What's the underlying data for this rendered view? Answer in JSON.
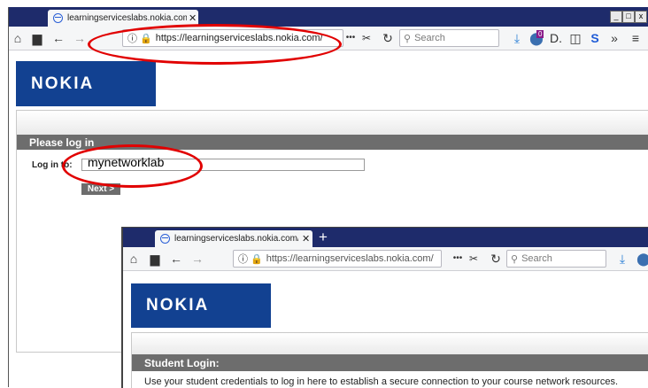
{
  "back_browser": {
    "tab_title": "learningserviceslabs.nokia.com/...",
    "url": "https://learningserviceslabs.nokia.com/",
    "search_placeholder": "Search",
    "more_label": "•••",
    "window_controls": {
      "minimize": "_",
      "maximize": "□",
      "close": "x"
    },
    "badge_count": "0"
  },
  "back_page": {
    "logo": "NOKIA",
    "section_title": "Please log in",
    "login_label": "Log in to:",
    "login_value": "mynetworklab",
    "next_button": "Next >"
  },
  "front_browser": {
    "tab_title": "learningserviceslabs.nokia.com/...",
    "new_tab": "+",
    "url": "https://learningserviceslabs.nokia.com/",
    "search_placeholder": "Search",
    "more_label": "•••"
  },
  "front_page": {
    "logo": "NOKIA",
    "section_title": "Student Login:",
    "description": "Use your student credentials to log in here to establish a secure connection to your course network resources."
  },
  "colors": {
    "titlebar": "#1e2b6b",
    "nokia_blue": "#124191",
    "section_bar": "#6d6d6d",
    "annotation": "#e10000"
  },
  "icons": [
    "home-icon",
    "print-icon",
    "back-icon",
    "forward-icon",
    "info-icon",
    "lock-icon",
    "reader-icon",
    "reload-icon",
    "search-icon",
    "download-icon",
    "extension-icon",
    "pocket-icon",
    "sidebar-icon",
    "sync-icon",
    "overflow-icon",
    "menu-icon"
  ]
}
